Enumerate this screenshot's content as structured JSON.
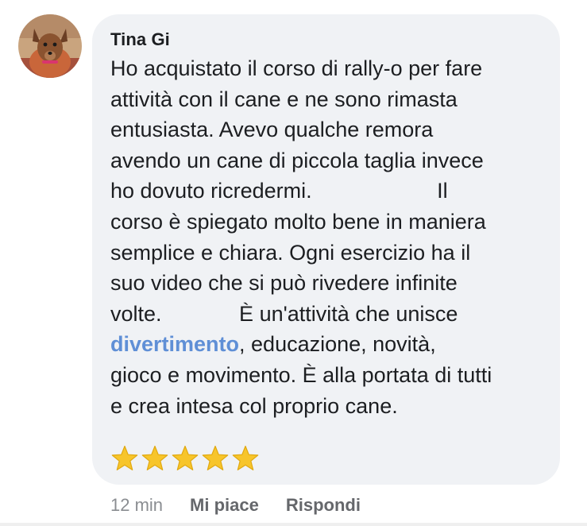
{
  "comment": {
    "author": "Tina Gi",
    "lines": [
      {
        "pre": "Ho acquistato il corso di rally-o per fare"
      },
      {
        "pre": "attività con il cane e ne sono rimasta"
      },
      {
        "pre": "entusiasta. Avevo qualche remora"
      },
      {
        "pre": "avendo un cane di piccola taglia invece"
      },
      {
        "pre": "ho dovuto ricredermi.                     Il"
      },
      {
        "pre": "corso è spiegato molto bene in maniera"
      },
      {
        "pre": "semplice e chiara. Ogni esercizio ha il"
      },
      {
        "pre": "suo video che si può rivedere infinite"
      },
      {
        "pre": "volte.             È un'attività che unisce"
      },
      {
        "pre": "",
        "link": "divertimento",
        "post": ", educazione, novità,"
      },
      {
        "pre": "gioco e movimento. È alla portata di tutti"
      },
      {
        "pre": "e crea intesa col proprio cane."
      }
    ],
    "rating_count": 5,
    "star_icon": "star-emoji-icon",
    "star_color": "#f7c52b"
  },
  "meta": {
    "timestamp": "12 min",
    "like_label": "Mi piace",
    "reply_label": "Rispondi"
  },
  "colors": {
    "bubble": "#f0f2f5",
    "link": "#5f8fd6",
    "text": "#1c1e21",
    "muted": "#65676b"
  }
}
